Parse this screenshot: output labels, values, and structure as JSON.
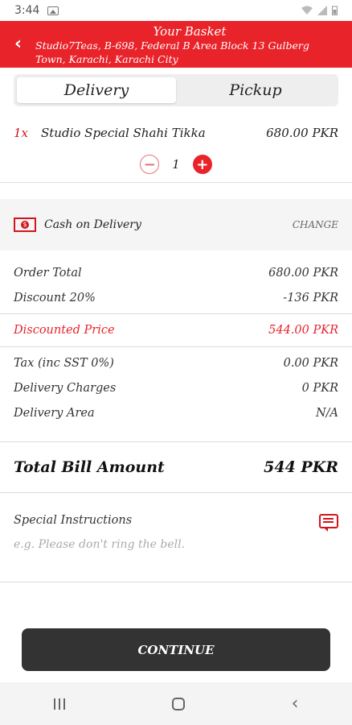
{
  "status_bar": {
    "time": "3:44"
  },
  "header": {
    "title": "Your Basket",
    "address_line1": "Studio7Teas, B-698, Federal B Area Block 13 Gulberg",
    "address_line2": "Town, Karachi, Karachi City"
  },
  "tabs": {
    "delivery": "Delivery",
    "pickup": "Pickup",
    "active": "delivery"
  },
  "item": {
    "qty_label": "1x",
    "name": "Studio Special Shahi Tikka",
    "price": "680.00 PKR",
    "stepper_value": "1"
  },
  "payment": {
    "method": "Cash on Delivery",
    "change_label": "CHANGE"
  },
  "summary": {
    "order_total_label": "Order Total",
    "order_total": "680.00 PKR",
    "discount_label": "Discount 20%",
    "discount": "-136 PKR",
    "discounted_label": "Discounted Price",
    "discounted": "544.00 PKR",
    "tax_label": "Tax (inc SST 0%)",
    "tax": "0.00 PKR",
    "delivery_charges_label": "Delivery Charges",
    "delivery_charges": "0 PKR",
    "delivery_area_label": "Delivery Area",
    "delivery_area": "N/A"
  },
  "total": {
    "label": "Total Bill Amount",
    "value": "544 PKR"
  },
  "instructions": {
    "label": "Special Instructions",
    "placeholder": "e.g. Please don't ring the bell."
  },
  "continue_label": "CONTINUE",
  "colors": {
    "accent": "#e8232a",
    "button": "#333333"
  }
}
